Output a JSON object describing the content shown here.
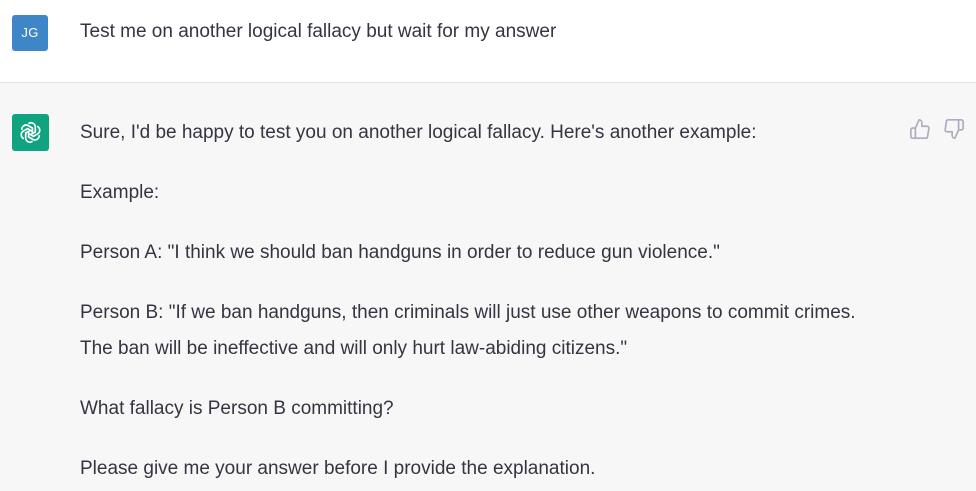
{
  "user": {
    "avatar_initials": "JG",
    "avatar_color": "#3f86c9",
    "message": "Test me on another logical fallacy but wait for my answer"
  },
  "assistant": {
    "avatar_icon": "openai-logo-icon",
    "avatar_color": "#10a37f",
    "paragraphs": [
      "Sure, I'd be happy to test you on another logical fallacy. Here's another example:",
      "Example:",
      "Person A: \"I think we should ban handguns in order to reduce gun violence.\"",
      "Person B: \"If we ban handguns, then criminals will just use other weapons to commit crimes.",
      "The ban will be ineffective and will only hurt law-abiding citizens.\"",
      "What fallacy is Person B committing?",
      "Please give me your answer before I provide the explanation."
    ],
    "feedback": {
      "thumbs_up_icon": "thumbs-up-icon",
      "thumbs_down_icon": "thumbs-down-icon"
    }
  }
}
